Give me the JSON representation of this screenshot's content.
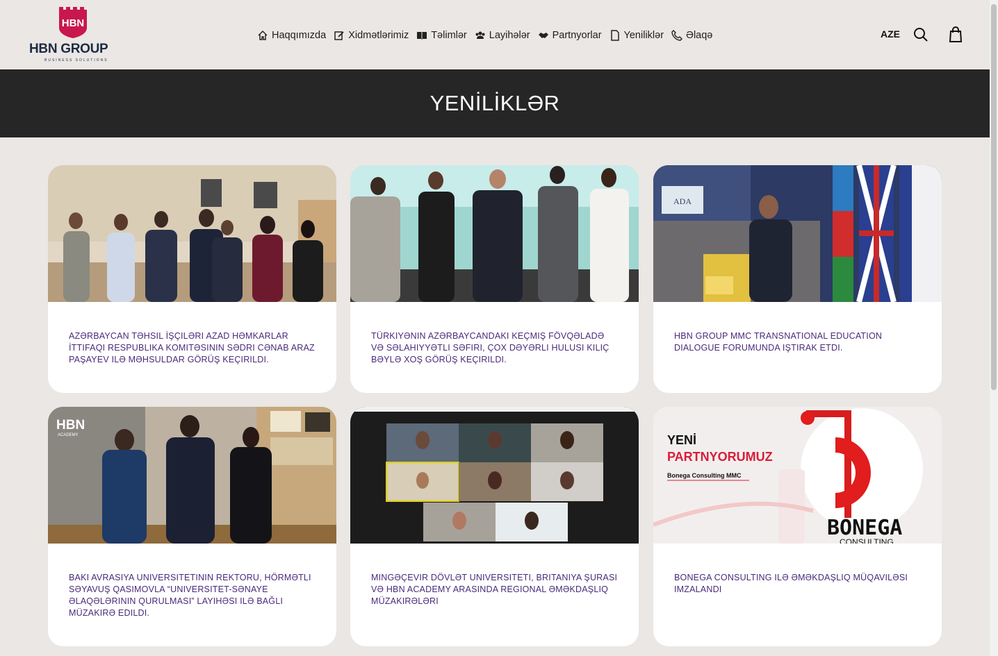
{
  "header": {
    "logo": {
      "mark": "HBN",
      "brand": "HBN GROUP",
      "tagline": "BUSINESS SOLUTIONS"
    },
    "nav": [
      {
        "label": "Haqqımızda",
        "icon": "home-icon"
      },
      {
        "label": "Xidmətlərimiz",
        "icon": "edit-icon"
      },
      {
        "label": "Təlimlər",
        "icon": "book-icon"
      },
      {
        "label": "Layihələr",
        "icon": "users-icon"
      },
      {
        "label": "Partnyorlar",
        "icon": "handshake-icon"
      },
      {
        "label": "Yeniliklər",
        "icon": "document-icon"
      },
      {
        "label": "Əlaqə",
        "icon": "phone-icon"
      }
    ],
    "language": "AZE"
  },
  "banner": {
    "title": "YENİLİKLƏR"
  },
  "cards": [
    {
      "title": "Azərbaycan Təhsil İşçiləri Azad Həmkarlar İttifaqı Respublika Komitəsinin sədri cənab Araz Paşayev ilə məhsuldar görüş keçirildi."
    },
    {
      "title": "Türkiyənin Azərbaycandakı keçmiş Fövqəladə və Səlahiyyətli Səfiri, çox dəyərli Hulusi Kılıç bəylə xoş görüş keçirildi."
    },
    {
      "title": "HBN GROUP MMC Transnational Education Dialogue Forumunda iştirak etdi."
    },
    {
      "title": "Bakı Avrasiya Universitetinin Rektoru, hörmətli Səyavuş Qasımovla “Universitet-sənaye əlaqələrinin qurulması” layihəsi ilə bağlı müzakirə edildi."
    },
    {
      "title": "Mingəçevir Dövlət Universiteti, Britaniya Şurası və HBN Academy arasında regional əməkdaşlıq müzakirələri"
    },
    {
      "title": "Bonega Consulting ilə əməkdaşlıq müqaviləsi imzalandı"
    }
  ],
  "images": {
    "card3": {
      "logo": "ADA"
    },
    "card4": {
      "logo": "HBN",
      "sublogo": "ACADEMY"
    },
    "card6": {
      "line1": "YENİ",
      "line2": "PARTNYORUMUZ",
      "line3": "Bonega Consulting MMC",
      "brand": "BONEGA",
      "brand_sub": "CONSULTING"
    }
  },
  "colors": {
    "accent": "#c8174f",
    "title_purple": "#4a2a7a",
    "banner_bg": "#262626",
    "page_bg": "#eae7e4"
  }
}
